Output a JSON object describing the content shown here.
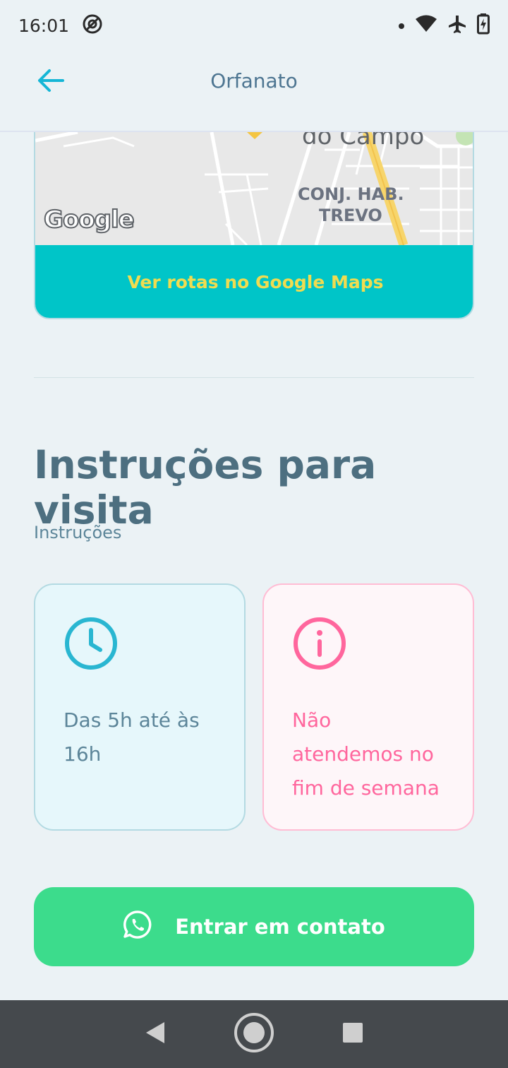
{
  "status": {
    "time": "16:01",
    "icons": [
      "at-sign-icon",
      "dot-icon",
      "wifi-icon",
      "airplane-icon",
      "battery-charging-icon"
    ]
  },
  "header": {
    "title": "Orfanato",
    "back_icon": "arrow-left-icon"
  },
  "map": {
    "labels": {
      "area_top": "do Campo",
      "area_mid_1": "CONJ. HAB.",
      "area_mid_2": "TREVO",
      "logo": "Google"
    },
    "route_button_label": "Ver rotas no Google Maps"
  },
  "instructions": {
    "title": "Instruções para visita",
    "subtitle": "Instruções",
    "cards": [
      {
        "icon": "clock-icon",
        "text": "Das 5h até às 16h",
        "color": "#29b6d1"
      },
      {
        "icon": "info-icon",
        "text": "Não atendemos no fim de semana",
        "color": "#ff669d"
      }
    ]
  },
  "contact": {
    "icon": "whatsapp-icon",
    "label": "Entrar em contato"
  },
  "navbar": {
    "icons": [
      "back-triangle-icon",
      "home-circle-icon",
      "recents-square-icon"
    ]
  },
  "colors": {
    "background": "#ebf2f5",
    "accent_cyan": "#00c5c8",
    "map_button_text": "#f0dc50",
    "contact_green": "#3cdc8c",
    "title_text": "#4d6f80",
    "weekend_pink": "#ff669d",
    "navbar": "#45494d"
  }
}
